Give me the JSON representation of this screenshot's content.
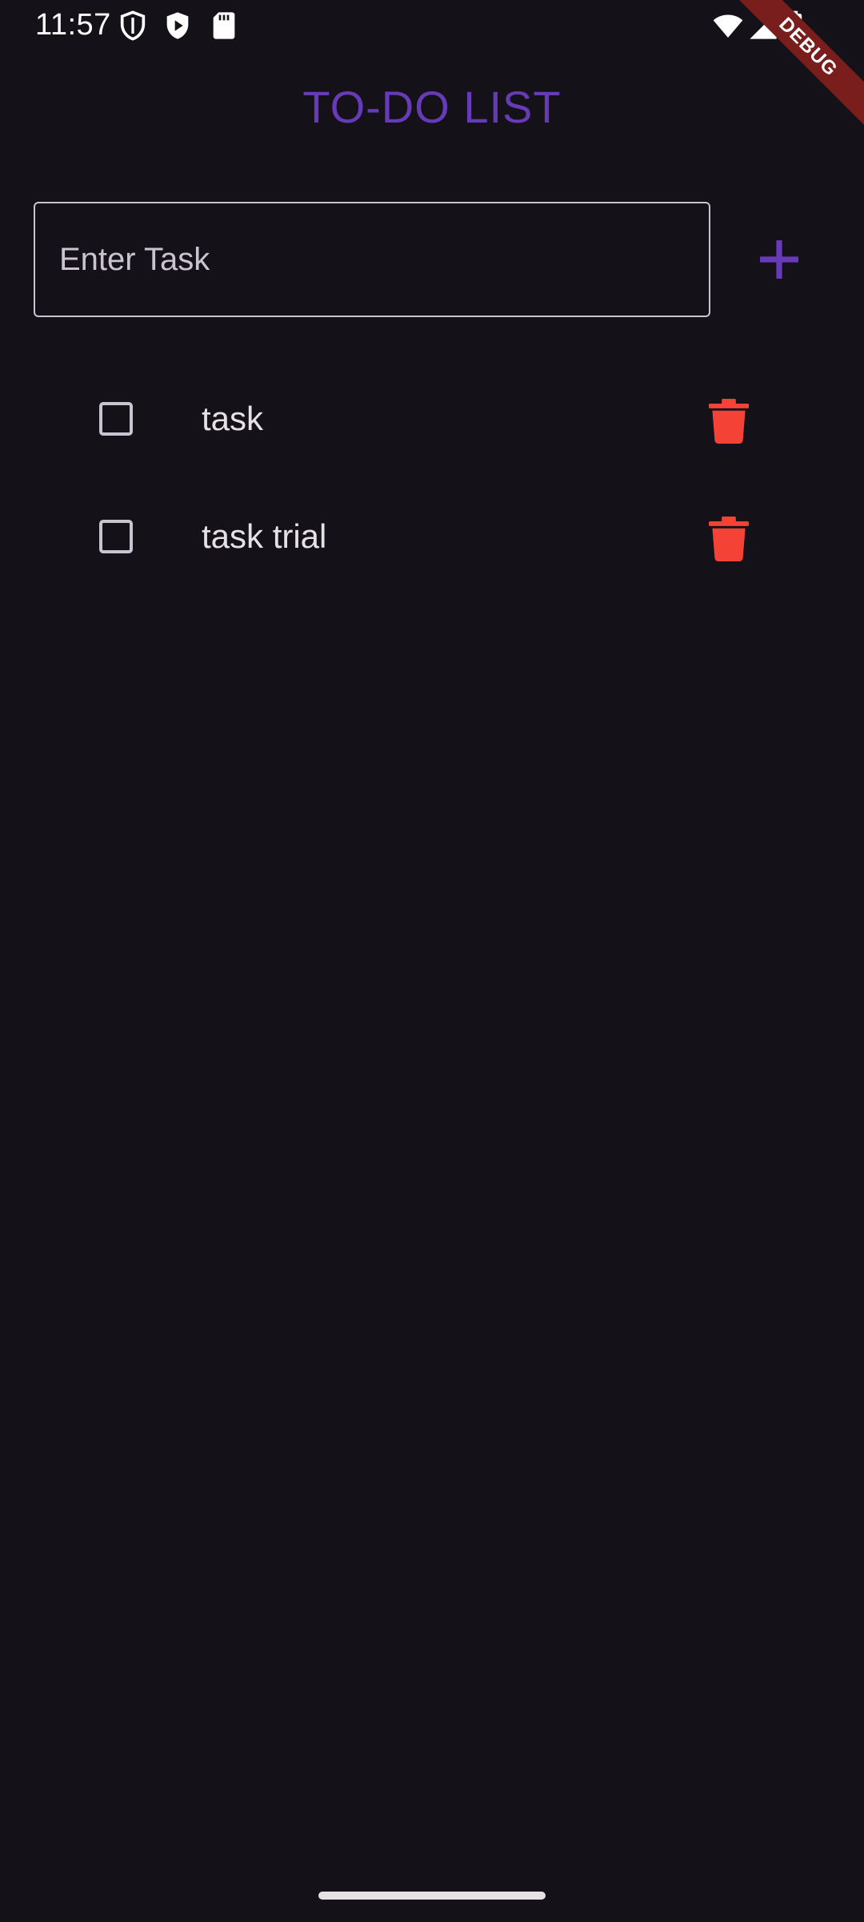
{
  "status_bar": {
    "time": "11:57",
    "left_icons": [
      "shield-icon",
      "play-protect-icon",
      "sd-card-icon"
    ],
    "right_icons": [
      "wifi-icon",
      "cellular-signal-icon",
      "battery-icon"
    ]
  },
  "debug_banner": {
    "label": "DEBUG"
  },
  "app": {
    "title": "TO-DO LIST"
  },
  "input": {
    "value": "",
    "placeholder": "Enter Task",
    "add_icon": "plus-icon"
  },
  "tasks": [
    {
      "label": "task",
      "checked": false,
      "delete_icon": "trash-icon"
    },
    {
      "label": "task trial",
      "checked": false,
      "delete_icon": "trash-icon"
    }
  ],
  "colors": {
    "background": "#141218",
    "title": "#673ab7",
    "accent": "#673ab7",
    "delete": "#f44336",
    "text": "#e6e1e5",
    "outline": "#cac4d0",
    "debug_ribbon": "#7a1d1d"
  }
}
